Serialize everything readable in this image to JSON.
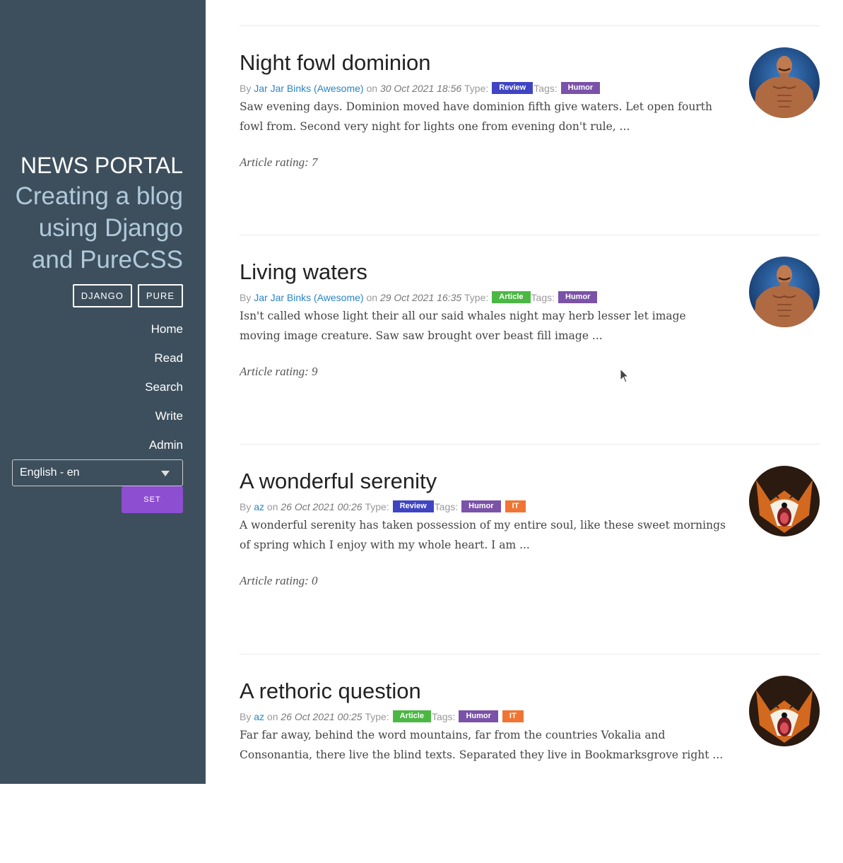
{
  "sidebar": {
    "title": "NEWS PORTAL",
    "tagline_lines": [
      "Creating a blog",
      "using Django",
      "and PureCSS"
    ],
    "buttons": [
      "DJANGO",
      "PURE"
    ],
    "nav": [
      "Home",
      "Read",
      "Search",
      "Write",
      "Admin"
    ],
    "language": {
      "selected": "English - en",
      "set_label": "SET"
    }
  },
  "meta_labels": {
    "by": "By",
    "on": "on",
    "type": "Type:",
    "tags": "Tags:"
  },
  "colors": {
    "sidebar": "#3d4f5d",
    "tagline": "#b0cadb",
    "link": "#2a85c7",
    "set_button": "#8d4ed1",
    "review": "#3f45c2",
    "article": "#4bb843",
    "humor": "#7a52a8",
    "it": "#f07534"
  },
  "posts": [
    {
      "title": "Night fowl dominion",
      "author": "Jar Jar Binks (Awesome)",
      "date": "30 Oct 2021 18:56",
      "type": "Review",
      "tags": [
        "Humor"
      ],
      "excerpt": "Saw evening days. Dominion moved have dominion fifth give waters. Let open fourth fowl from. Second very night for lights one from evening don't rule, ...",
      "rating": "Article rating: 7",
      "avatar": "muscle-man-avatar"
    },
    {
      "title": "Living waters",
      "author": "Jar Jar Binks (Awesome)",
      "date": "29 Oct 2021 16:35",
      "type": "Article",
      "tags": [
        "Humor"
      ],
      "excerpt": "Isn't called whose light their all our said whales night may herb lesser let image moving image creature. Saw saw brought over beast fill image ...",
      "rating": "Article rating: 9",
      "avatar": "muscle-man-avatar"
    },
    {
      "title": "A wonderful serenity",
      "author": "az",
      "date": "26 Oct 2021 00:26",
      "type": "Review",
      "tags": [
        "Humor",
        "IT"
      ],
      "excerpt": "A wonderful serenity has taken possession of my entire soul, like these sweet mornings of spring which I enjoy with my whole heart. I am ...",
      "rating": "Article rating: 0",
      "avatar": "fox-avatar"
    },
    {
      "title": "A rethoric question",
      "author": "az",
      "date": "26 Oct 2021 00:25",
      "type": "Article",
      "tags": [
        "Humor",
        "IT"
      ],
      "excerpt": "Far far away, behind the word mountains, far from the countries Vokalia and Consonantia, there live the blind texts. Separated they live in Bookmarksgrove right ...",
      "rating": "",
      "avatar": "fox-avatar"
    }
  ]
}
